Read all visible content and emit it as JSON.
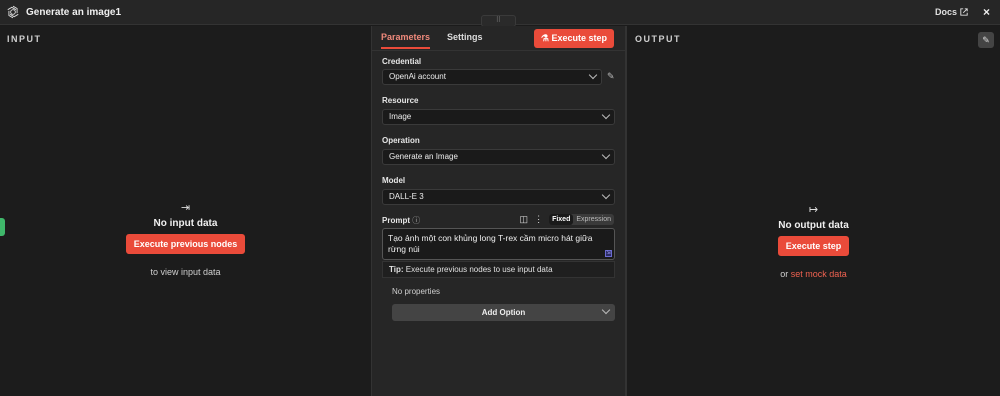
{
  "window": {
    "title": "Generate an image1",
    "docs_label": "Docs",
    "close_glyph": "×",
    "drag_handle_glyph": "⠿"
  },
  "input_pane": {
    "label": "INPUT",
    "empty_title": "No input data",
    "action_button": "Execute previous nodes",
    "hint": "to view input data"
  },
  "output_pane": {
    "label": "OUTPUT",
    "empty_title": "No output data",
    "action_button": "Execute step",
    "or_text": "or",
    "mock_link": "set mock data"
  },
  "parameters": {
    "tabs": [
      {
        "label": "Parameters",
        "active": true
      },
      {
        "label": "Settings",
        "active": false
      }
    ],
    "execute_button": "Execute step",
    "credential": {
      "label": "Credential",
      "value": "OpenAi account"
    },
    "resource": {
      "label": "Resource",
      "value": "Image"
    },
    "operation": {
      "label": "Operation",
      "value": "Generate an Image"
    },
    "model": {
      "label": "Model",
      "value": "DALL-E 3"
    },
    "prompt": {
      "label": "Prompt",
      "mode_fixed": "Fixed",
      "mode_expression": "Expression",
      "value": "Tạo ảnh một con khủng long T-rex cầm micro hát giữa rừng núi"
    },
    "tip": {
      "label": "Tip:",
      "text": "Execute previous nodes to use input data"
    },
    "no_properties": "No properties",
    "add_option": "Add Option"
  },
  "colors": {
    "accent": "#ea4b3a",
    "background": "#1b1b1b",
    "panel": "#262626"
  },
  "icons": {
    "logo": "openai-logo-icon",
    "docs": "external-link-icon",
    "input_empty": "arrow-to-right-icon",
    "output_empty": "arrow-right-icon",
    "execute": "flask-icon",
    "credential_edit": "pencil-icon",
    "prompt_help": "help-circle-icon",
    "prompt_expand": "panel-icon",
    "prompt_more": "more-vertical-icon"
  }
}
